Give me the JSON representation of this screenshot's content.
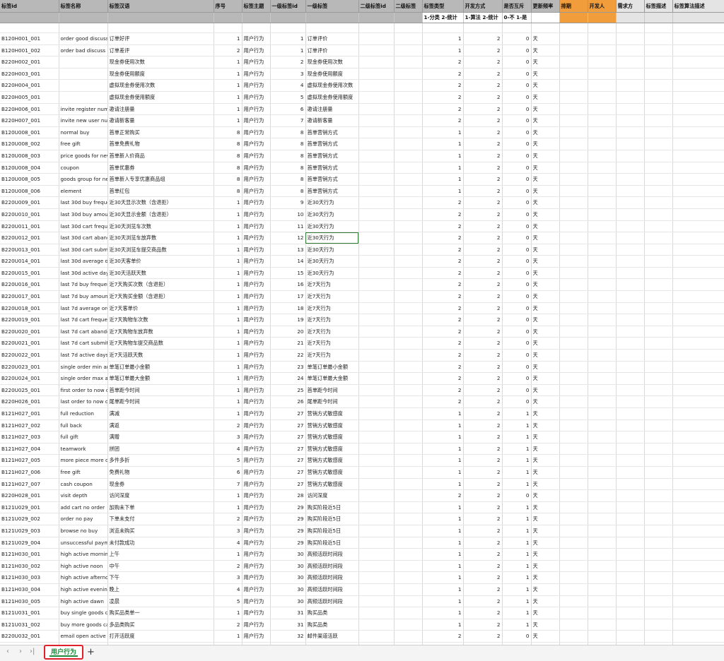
{
  "sheet": {
    "columns": [
      "标签id",
      "标签名称",
      "标签汉语",
      "序号",
      "标签主题",
      "一级标签id",
      "一级标签",
      "二级标签id",
      "二级标签",
      "标签类型",
      "开发方式",
      "是否互斥",
      "更新频率",
      "排期",
      "开发人",
      "需求方",
      "标签描述",
      "标签算法描述"
    ],
    "subheader": [
      "",
      "",
      "",
      "",
      "",
      "",
      "",
      "",
      "",
      "1-分类 2-统计",
      "1-算法 2-统计",
      "0-不 1-是",
      "",
      "",
      "",
      "",
      "",
      ""
    ],
    "rows": [
      [
        "B120H001_001",
        "order good discuss",
        "订单好评",
        "1",
        "用户行为",
        "1",
        "订单评价",
        "",
        "",
        "1",
        "2",
        "0",
        "天"
      ],
      [
        "B120H001_002",
        "order bad discuss",
        "订单差评",
        "2",
        "用户行为",
        "1",
        "订单评价",
        "",
        "",
        "1",
        "2",
        "0",
        "天"
      ],
      [
        "B220H002_001",
        "",
        "现金券使用次数",
        "1",
        "用户行为",
        "2",
        "现金券使用次数",
        "",
        "",
        "2",
        "2",
        "0",
        "天"
      ],
      [
        "B220H003_001",
        "",
        "现金券使用额度",
        "1",
        "用户行为",
        "3",
        "现金券使用额度",
        "",
        "",
        "2",
        "2",
        "0",
        "天"
      ],
      [
        "B220H004_001",
        "",
        "虚拟现金券使用次数",
        "1",
        "用户行为",
        "4",
        "虚拟现金券使用次数",
        "",
        "",
        "2",
        "2",
        "0",
        "天"
      ],
      [
        "B220H005_001",
        "",
        "虚拟现金券使用额度",
        "1",
        "用户行为",
        "5",
        "虚拟现金券使用额度",
        "",
        "",
        "2",
        "2",
        "0",
        "天"
      ],
      [
        "B220H006_001",
        "invite register num",
        "邀请注册量",
        "1",
        "用户行为",
        "6",
        "邀请注册量",
        "",
        "",
        "2",
        "2",
        "0",
        "天"
      ],
      [
        "B220H007_001",
        "invite new user num",
        "邀请新客量",
        "1",
        "用户行为",
        "7",
        "邀请新客量",
        "",
        "",
        "2",
        "2",
        "0",
        "天"
      ],
      [
        "B120U008_001",
        "normal buy",
        "首单正常购买",
        "8",
        "用户行为",
        "8",
        "首单营销方式",
        "",
        "",
        "1",
        "2",
        "0",
        "天"
      ],
      [
        "B120U008_002",
        "free gift",
        "首单免费礼物",
        "8",
        "用户行为",
        "8",
        "首单营销方式",
        "",
        "",
        "1",
        "2",
        "0",
        "天"
      ],
      [
        "B120U008_003",
        "price goods for new",
        "首单新人价商品",
        "8",
        "用户行为",
        "8",
        "首单营销方式",
        "",
        "",
        "1",
        "2",
        "0",
        "天"
      ],
      [
        "B120U008_004",
        "coupon",
        "首单优惠券",
        "8",
        "用户行为",
        "8",
        "首单营销方式",
        "",
        "",
        "1",
        "2",
        "0",
        "天"
      ],
      [
        "B120U008_005",
        "goods group for new",
        "首单新人专享优惠商品组",
        "8",
        "用户行为",
        "8",
        "首单营销方式",
        "",
        "",
        "1",
        "2",
        "0",
        "天"
      ],
      [
        "B120U008_006",
        "element",
        "首单红包",
        "8",
        "用户行为",
        "8",
        "首单营销方式",
        "",
        "",
        "1",
        "2",
        "0",
        "天"
      ],
      [
        "B220U009_001",
        "last 30d buy freque",
        "近30天显示次数（含退拒）",
        "1",
        "用户行为",
        "9",
        "近30天行为",
        "",
        "",
        "2",
        "2",
        "0",
        "天"
      ],
      [
        "B220U010_001",
        "last 30d buy amour",
        "近30天显示金额（含退拒）",
        "1",
        "用户行为",
        "10",
        "近30天行为",
        "",
        "",
        "2",
        "2",
        "0",
        "天"
      ],
      [
        "B220U011_001",
        "last 30d cart freque",
        "近30天浏览车次数",
        "1",
        "用户行为",
        "11",
        "近30天行为",
        "",
        "",
        "2",
        "2",
        "0",
        "天"
      ],
      [
        "B220U012_001",
        "last 30d cart aband",
        "近30天浏览车放弃数",
        "1",
        "用户行为",
        "12",
        "近30天行为",
        "",
        "",
        "2",
        "2",
        "0",
        "天"
      ],
      [
        "B220U013_001",
        "last 30d cart submi",
        "近30天浏览车提交商品数",
        "1",
        "用户行为",
        "13",
        "近30天行为",
        "",
        "",
        "2",
        "2",
        "0",
        "天"
      ],
      [
        "B220U014_001",
        "last 30d average or",
        "近30天客单价",
        "1",
        "用户行为",
        "14",
        "近30天行为",
        "",
        "",
        "2",
        "2",
        "0",
        "天"
      ],
      [
        "B220U015_001",
        "last 30d active days",
        "近30天活跃天数",
        "1",
        "用户行为",
        "15",
        "近30天行为",
        "",
        "",
        "2",
        "2",
        "0",
        "天"
      ],
      [
        "B220U016_001",
        "last 7d buy frequen",
        "近7天购买次数（含退拒）",
        "1",
        "用户行为",
        "16",
        "近7天行为",
        "",
        "",
        "2",
        "2",
        "0",
        "天"
      ],
      [
        "B220U017_001",
        "last 7d buy amount",
        "近7天购买金额（含退拒）",
        "1",
        "用户行为",
        "17",
        "近7天行为",
        "",
        "",
        "2",
        "2",
        "0",
        "天"
      ],
      [
        "B220U018_001",
        "last 7d average ord",
        "近7天客单价",
        "1",
        "用户行为",
        "18",
        "近7天行为",
        "",
        "",
        "2",
        "2",
        "0",
        "天"
      ],
      [
        "B220U019_001",
        "last 7d cart frequer",
        "近7天购物车次数",
        "1",
        "用户行为",
        "19",
        "近7天行为",
        "",
        "",
        "2",
        "2",
        "0",
        "天"
      ],
      [
        "B220U020_001",
        "last 7d cart abando",
        "近7天购物车放弃数",
        "1",
        "用户行为",
        "20",
        "近7天行为",
        "",
        "",
        "2",
        "2",
        "0",
        "天"
      ],
      [
        "B220U021_001",
        "last 7d cart submit",
        "近7天购物车提交商品数",
        "1",
        "用户行为",
        "21",
        "近7天行为",
        "",
        "",
        "2",
        "2",
        "0",
        "天"
      ],
      [
        "B220U022_001",
        "last 7d active days",
        "近7天活跃天数",
        "1",
        "用户行为",
        "22",
        "近7天行为",
        "",
        "",
        "2",
        "2",
        "0",
        "天"
      ],
      [
        "B220U023_001",
        "single order min am",
        "单笔订单最小金额",
        "1",
        "用户行为",
        "23",
        "单笔订单最小金额",
        "",
        "",
        "2",
        "2",
        "0",
        "天"
      ],
      [
        "B220U024_001",
        "single order max am",
        "单笔订单最大金额",
        "1",
        "用户行为",
        "24",
        "单笔订单最大金额",
        "",
        "",
        "2",
        "2",
        "0",
        "天"
      ],
      [
        "B220U025_001",
        "first order to now da",
        "首单距今时间",
        "1",
        "用户行为",
        "25",
        "首单距今时间",
        "",
        "",
        "2",
        "2",
        "0",
        "天"
      ],
      [
        "B220H026_001",
        "last order to now da",
        "尾单距今时间",
        "1",
        "用户行为",
        "26",
        "尾单距今时间",
        "",
        "",
        "2",
        "2",
        "0",
        "天"
      ],
      [
        "B121H027_001",
        "full reduction",
        "满减",
        "1",
        "用户行为",
        "27",
        "营销方式敏感度",
        "",
        "",
        "1",
        "2",
        "1",
        "天"
      ],
      [
        "B121H027_002",
        "full back",
        "满返",
        "2",
        "用户行为",
        "27",
        "营销方式敏感度",
        "",
        "",
        "1",
        "2",
        "1",
        "天"
      ],
      [
        "B121H027_003",
        "full gift",
        "满赠",
        "3",
        "用户行为",
        "27",
        "营销方式敏感度",
        "",
        "",
        "1",
        "2",
        "1",
        "天"
      ],
      [
        "B121H027_004",
        "teamwork",
        "拼团",
        "4",
        "用户行为",
        "27",
        "营销方式敏感度",
        "",
        "",
        "1",
        "2",
        "1",
        "天"
      ],
      [
        "B121H027_005",
        "more piece more dis",
        "多件多折",
        "5",
        "用户行为",
        "27",
        "营销方式敏感度",
        "",
        "",
        "1",
        "2",
        "1",
        "天"
      ],
      [
        "B121H027_006",
        "free gift",
        "免费礼物",
        "6",
        "用户行为",
        "27",
        "营销方式敏感度",
        "",
        "",
        "1",
        "2",
        "1",
        "天"
      ],
      [
        "B121H027_007",
        "cash coupon",
        "现金券",
        "7",
        "用户行为",
        "27",
        "营销方式敏感度",
        "",
        "",
        "1",
        "2",
        "1",
        "天"
      ],
      [
        "B220H028_001",
        "visit depth",
        "访问深度",
        "1",
        "用户行为",
        "28",
        "访问深度",
        "",
        "",
        "2",
        "2",
        "0",
        "天"
      ],
      [
        "B121U029_001",
        "add cart no order",
        "加购未下单",
        "1",
        "用户行为",
        "29",
        "购买阶段近5日",
        "",
        "",
        "1",
        "2",
        "1",
        "天"
      ],
      [
        "B121U029_002",
        "order no pay",
        "下单未支付",
        "2",
        "用户行为",
        "29",
        "购买阶段近5日",
        "",
        "",
        "1",
        "2",
        "1",
        "天"
      ],
      [
        "B121U029_003",
        "browse no buy",
        "浏览未购买",
        "3",
        "用户行为",
        "29",
        "购买阶段近5日",
        "",
        "",
        "1",
        "2",
        "1",
        "天"
      ],
      [
        "B121U029_004",
        "unsuccessful payme",
        "未付款成功",
        "4",
        "用户行为",
        "29",
        "购买阶段近5日",
        "",
        "",
        "1",
        "2",
        "1",
        "天"
      ],
      [
        "B121H030_001",
        "high active morning",
        "上午",
        "1",
        "用户行为",
        "30",
        "高频活跃时间段",
        "",
        "",
        "1",
        "2",
        "1",
        "天"
      ],
      [
        "B121H030_002",
        "high active noon",
        "中午",
        "2",
        "用户行为",
        "30",
        "高频活跃时间段",
        "",
        "",
        "1",
        "2",
        "1",
        "天"
      ],
      [
        "B121H030_003",
        "high active afterno",
        "下午",
        "3",
        "用户行为",
        "30",
        "高频活跃时间段",
        "",
        "",
        "1",
        "2",
        "1",
        "天"
      ],
      [
        "B121H030_004",
        "high active evening",
        "晚上",
        "4",
        "用户行为",
        "30",
        "高频活跃时间段",
        "",
        "",
        "1",
        "2",
        "1",
        "天"
      ],
      [
        "B121H030_005",
        "high active dawn",
        "凌晨",
        "5",
        "用户行为",
        "30",
        "高频活跃时间段",
        "",
        "",
        "1",
        "2",
        "1",
        "天"
      ],
      [
        "B121U031_001",
        "buy single goods ca",
        "购买品类单一",
        "1",
        "用户行为",
        "31",
        "购买品类",
        "",
        "",
        "1",
        "2",
        "1",
        "天"
      ],
      [
        "B121U031_002",
        "buy more goods ca",
        "多品类购买",
        "2",
        "用户行为",
        "31",
        "购买品类",
        "",
        "",
        "1",
        "2",
        "1",
        "天"
      ],
      [
        "B220U032_001",
        "email open active",
        "打开活跃度",
        "1",
        "用户行为",
        "32",
        "邮件渠道活跃",
        "",
        "",
        "2",
        "2",
        "0",
        "天"
      ],
      [
        "B220U032_002",
        "email conversion ac",
        "转化活跃度",
        "2",
        "用户行为",
        "32",
        "邮件渠道活跃",
        "",
        "",
        "2",
        "2",
        "0",
        "天"
      ]
    ]
  },
  "bottom": {
    "nav_first": "‹",
    "nav_next": "›",
    "nav_last": "›|",
    "tab_label": "用户行为",
    "add_label": "+"
  }
}
